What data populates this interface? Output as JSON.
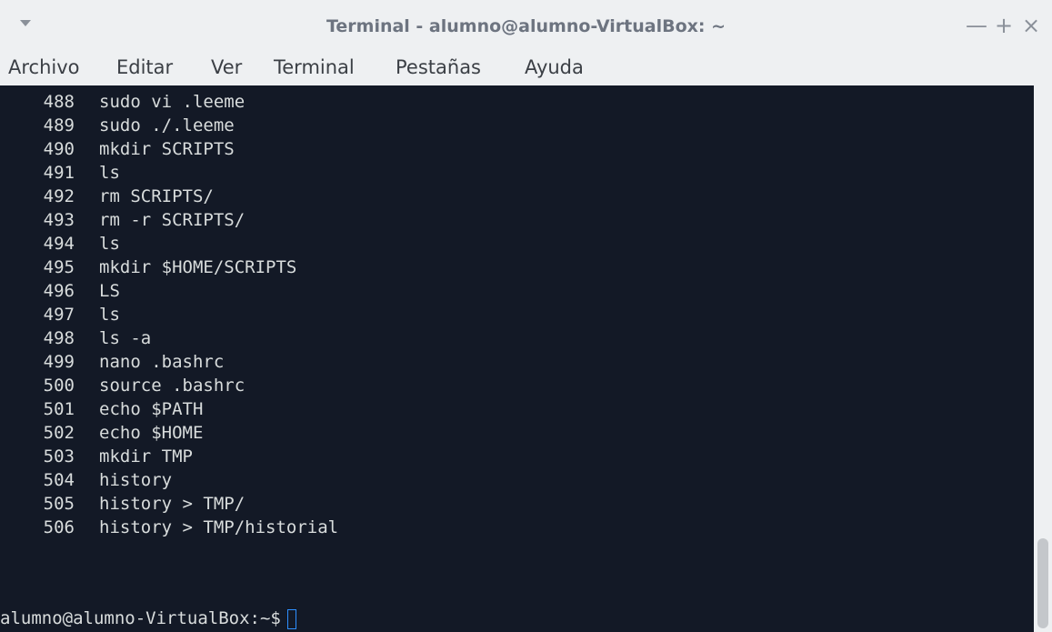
{
  "window": {
    "title": "Terminal - alumno@alumno-VirtualBox: ~",
    "controls": {
      "minimize": "—",
      "maximize": "+",
      "close": "×"
    }
  },
  "menubar": {
    "items": [
      "Archivo",
      "Editar",
      "Ver",
      "Terminal",
      "Pestañas",
      "Ayuda"
    ]
  },
  "terminal": {
    "history": [
      {
        "num": "488",
        "cmd": "sudo vi .leeme"
      },
      {
        "num": "489",
        "cmd": "sudo ./.leeme"
      },
      {
        "num": "490",
        "cmd": "mkdir SCRIPTS"
      },
      {
        "num": "491",
        "cmd": "ls"
      },
      {
        "num": "492",
        "cmd": "rm SCRIPTS/"
      },
      {
        "num": "493",
        "cmd": "rm -r SCRIPTS/"
      },
      {
        "num": "494",
        "cmd": "ls"
      },
      {
        "num": "495",
        "cmd": "mkdir $HOME/SCRIPTS"
      },
      {
        "num": "496",
        "cmd": "LS"
      },
      {
        "num": "497",
        "cmd": "ls"
      },
      {
        "num": "498",
        "cmd": "ls -a"
      },
      {
        "num": "499",
        "cmd": "nano .bashrc"
      },
      {
        "num": "500",
        "cmd": "source .bashrc"
      },
      {
        "num": "501",
        "cmd": "echo $PATH"
      },
      {
        "num": "502",
        "cmd": "echo $HOME"
      },
      {
        "num": "503",
        "cmd": "mkdir TMP"
      },
      {
        "num": "504",
        "cmd": "history"
      },
      {
        "num": "505",
        "cmd": "history > TMP/"
      },
      {
        "num": "506",
        "cmd": "history > TMP/historial"
      }
    ],
    "prompt": "alumno@alumno-VirtualBox:~$"
  },
  "colors": {
    "background": "#131926",
    "text": "#d8dcdc",
    "cursor": "#2e8fff",
    "chrome": "#eef0f2"
  }
}
